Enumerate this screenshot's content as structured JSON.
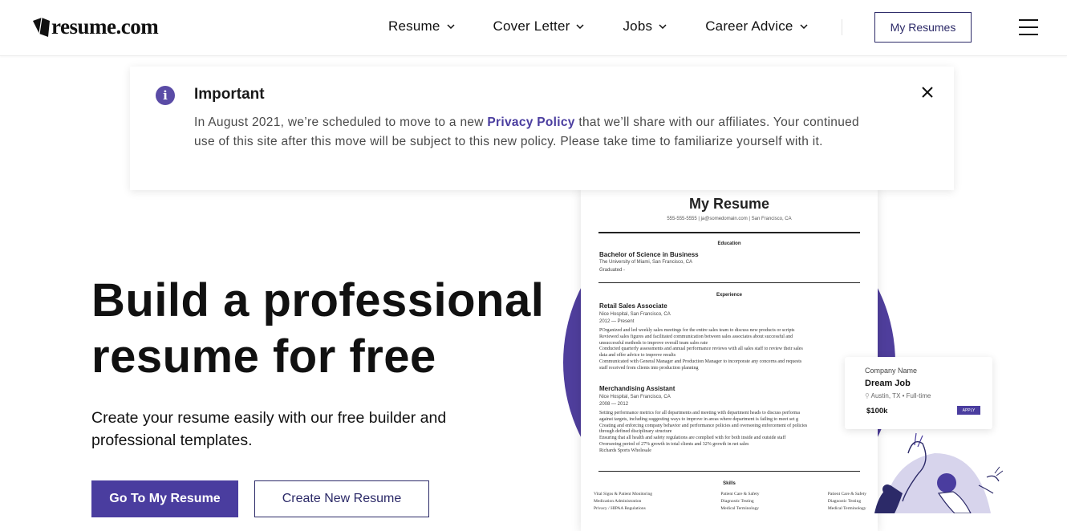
{
  "header": {
    "logo_text": "resume.com",
    "nav": [
      "Resume",
      "Cover Letter",
      "Jobs",
      "Career Advice"
    ],
    "my_resumes": "My Resumes"
  },
  "notice": {
    "title": "Important",
    "body_before": "In August 2021, we’re scheduled to move to a new ",
    "link": "Privacy Policy",
    "body_after": " that we’ll share with our affiliates. Your continued use of this site after this move will be subject to this new policy. Please take time to familiarize yourself with it."
  },
  "hero": {
    "title_line1": "Build a professional",
    "title_line2": "resume for free",
    "subtitle": "Create your resume easily with our free builder and professional templates.",
    "primary_button": "Go To My Resume",
    "secondary_button": "Create New Resume"
  },
  "resume_preview": {
    "name": "My Resume",
    "contact": "555-555-5555 | ja@somedomain.com | San Francisco, CA",
    "education_heading": "Education",
    "degree": "Bachelor of Science in Business",
    "school": "The University of Miami, San Francisco, CA",
    "graduated": "Graduated -",
    "experience_heading": "Experience",
    "job1_title": "Retail Sales Associate",
    "job1_place": "Nice Hospital, San Francisco, CA",
    "job1_dates": "2012 — Present",
    "job1_lines": [
      "POrganized and led weekly sales meetings for the entire sales team to discuss new products or scripts",
      "Reviewed sales figures and facilitated communication between sales associates about successful and",
      "unsuccessful methods to improve overall team sales rate",
      "Conducted quarterly assessments and annual performance reviews with all sales staff to review their sales",
      "data and offer advice to improve results",
      "Communicated with General Manager and Production Manager to incorporate any concerns and requests",
      "staff received from clients into production planning"
    ],
    "job2_title": "Merchandising Assistant",
    "job2_place": "Nice Hospital, San Francisco, CA",
    "job2_dates": "2008 — 2012",
    "job2_lines": [
      "Setting performance metrics for all departments and meeting with department heads to discuss performa",
      "against targets, including suggesting ways to improve in areas where department is failing to meet set g",
      "Creating and enforcing company behavior and performance policies and overseeing enforcement of policies",
      "through defined disciplinary structure",
      "Ensuring that all health and safety regulations are complied with for both inside and outside staff",
      "Overseeing period of 27% growth in total clients and 32% growth in net sales",
      "Richards Sports Wholesale"
    ],
    "skills_heading": "Skills",
    "skills_col1": [
      "Vital Signs & Patient Monitoring",
      "Medication Administration",
      "Privacy / HIPAA Regulations"
    ],
    "skills_col2": [
      "Patient Care & Safety",
      "Diagnostic Testing",
      "Medical Terminology"
    ],
    "skills_col3": [
      "Patient Care & Safety",
      "Diagnostic Testing",
      "Medical Terminology"
    ]
  },
  "job_card": {
    "company": "Company Name",
    "title": "Dream Job",
    "location": "Austin, TX • Full-time",
    "salary": "$100k",
    "apply": "APPLY"
  },
  "colors": {
    "brand_purple": "#4a3d9f",
    "navy_border": "#2c2a68"
  }
}
